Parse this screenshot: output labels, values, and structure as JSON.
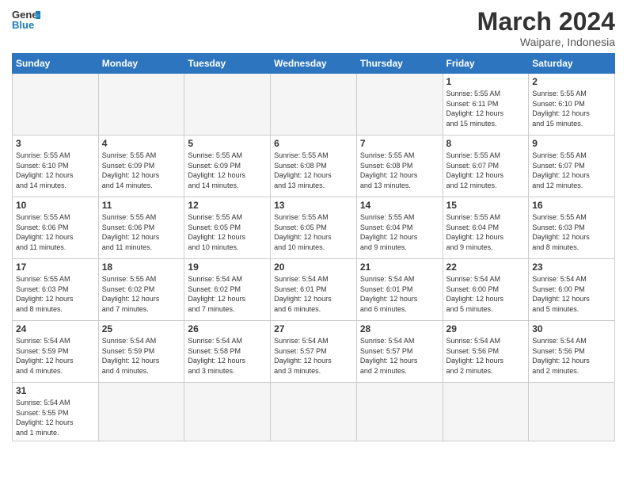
{
  "logo": {
    "line1": "General",
    "line2": "Blue"
  },
  "title": "March 2024",
  "subtitle": "Waipare, Indonesia",
  "days_of_week": [
    "Sunday",
    "Monday",
    "Tuesday",
    "Wednesday",
    "Thursday",
    "Friday",
    "Saturday"
  ],
  "weeks": [
    [
      {
        "day": "",
        "info": "",
        "empty": true
      },
      {
        "day": "",
        "info": "",
        "empty": true
      },
      {
        "day": "",
        "info": "",
        "empty": true
      },
      {
        "day": "",
        "info": "",
        "empty": true
      },
      {
        "day": "",
        "info": "",
        "empty": true
      },
      {
        "day": "1",
        "info": "Sunrise: 5:55 AM\nSunset: 6:11 PM\nDaylight: 12 hours\nand 15 minutes."
      },
      {
        "day": "2",
        "info": "Sunrise: 5:55 AM\nSunset: 6:10 PM\nDaylight: 12 hours\nand 15 minutes."
      }
    ],
    [
      {
        "day": "3",
        "info": "Sunrise: 5:55 AM\nSunset: 6:10 PM\nDaylight: 12 hours\nand 14 minutes."
      },
      {
        "day": "4",
        "info": "Sunrise: 5:55 AM\nSunset: 6:09 PM\nDaylight: 12 hours\nand 14 minutes."
      },
      {
        "day": "5",
        "info": "Sunrise: 5:55 AM\nSunset: 6:09 PM\nDaylight: 12 hours\nand 14 minutes."
      },
      {
        "day": "6",
        "info": "Sunrise: 5:55 AM\nSunset: 6:08 PM\nDaylight: 12 hours\nand 13 minutes."
      },
      {
        "day": "7",
        "info": "Sunrise: 5:55 AM\nSunset: 6:08 PM\nDaylight: 12 hours\nand 13 minutes."
      },
      {
        "day": "8",
        "info": "Sunrise: 5:55 AM\nSunset: 6:07 PM\nDaylight: 12 hours\nand 12 minutes."
      },
      {
        "day": "9",
        "info": "Sunrise: 5:55 AM\nSunset: 6:07 PM\nDaylight: 12 hours\nand 12 minutes."
      }
    ],
    [
      {
        "day": "10",
        "info": "Sunrise: 5:55 AM\nSunset: 6:06 PM\nDaylight: 12 hours\nand 11 minutes."
      },
      {
        "day": "11",
        "info": "Sunrise: 5:55 AM\nSunset: 6:06 PM\nDaylight: 12 hours\nand 11 minutes."
      },
      {
        "day": "12",
        "info": "Sunrise: 5:55 AM\nSunset: 6:05 PM\nDaylight: 12 hours\nand 10 minutes."
      },
      {
        "day": "13",
        "info": "Sunrise: 5:55 AM\nSunset: 6:05 PM\nDaylight: 12 hours\nand 10 minutes."
      },
      {
        "day": "14",
        "info": "Sunrise: 5:55 AM\nSunset: 6:04 PM\nDaylight: 12 hours\nand 9 minutes."
      },
      {
        "day": "15",
        "info": "Sunrise: 5:55 AM\nSunset: 6:04 PM\nDaylight: 12 hours\nand 9 minutes."
      },
      {
        "day": "16",
        "info": "Sunrise: 5:55 AM\nSunset: 6:03 PM\nDaylight: 12 hours\nand 8 minutes."
      }
    ],
    [
      {
        "day": "17",
        "info": "Sunrise: 5:55 AM\nSunset: 6:03 PM\nDaylight: 12 hours\nand 8 minutes."
      },
      {
        "day": "18",
        "info": "Sunrise: 5:55 AM\nSunset: 6:02 PM\nDaylight: 12 hours\nand 7 minutes."
      },
      {
        "day": "19",
        "info": "Sunrise: 5:54 AM\nSunset: 6:02 PM\nDaylight: 12 hours\nand 7 minutes."
      },
      {
        "day": "20",
        "info": "Sunrise: 5:54 AM\nSunset: 6:01 PM\nDaylight: 12 hours\nand 6 minutes."
      },
      {
        "day": "21",
        "info": "Sunrise: 5:54 AM\nSunset: 6:01 PM\nDaylight: 12 hours\nand 6 minutes."
      },
      {
        "day": "22",
        "info": "Sunrise: 5:54 AM\nSunset: 6:00 PM\nDaylight: 12 hours\nand 5 minutes."
      },
      {
        "day": "23",
        "info": "Sunrise: 5:54 AM\nSunset: 6:00 PM\nDaylight: 12 hours\nand 5 minutes."
      }
    ],
    [
      {
        "day": "24",
        "info": "Sunrise: 5:54 AM\nSunset: 5:59 PM\nDaylight: 12 hours\nand 4 minutes."
      },
      {
        "day": "25",
        "info": "Sunrise: 5:54 AM\nSunset: 5:59 PM\nDaylight: 12 hours\nand 4 minutes."
      },
      {
        "day": "26",
        "info": "Sunrise: 5:54 AM\nSunset: 5:58 PM\nDaylight: 12 hours\nand 3 minutes."
      },
      {
        "day": "27",
        "info": "Sunrise: 5:54 AM\nSunset: 5:57 PM\nDaylight: 12 hours\nand 3 minutes."
      },
      {
        "day": "28",
        "info": "Sunrise: 5:54 AM\nSunset: 5:57 PM\nDaylight: 12 hours\nand 2 minutes."
      },
      {
        "day": "29",
        "info": "Sunrise: 5:54 AM\nSunset: 5:56 PM\nDaylight: 12 hours\nand 2 minutes."
      },
      {
        "day": "30",
        "info": "Sunrise: 5:54 AM\nSunset: 5:56 PM\nDaylight: 12 hours\nand 2 minutes."
      }
    ],
    [
      {
        "day": "31",
        "info": "Sunrise: 5:54 AM\nSunset: 5:55 PM\nDaylight: 12 hours\nand 1 minute.",
        "last": true
      },
      {
        "day": "",
        "info": "",
        "empty": true,
        "last": true
      },
      {
        "day": "",
        "info": "",
        "empty": true,
        "last": true
      },
      {
        "day": "",
        "info": "",
        "empty": true,
        "last": true
      },
      {
        "day": "",
        "info": "",
        "empty": true,
        "last": true
      },
      {
        "day": "",
        "info": "",
        "empty": true,
        "last": true
      },
      {
        "day": "",
        "info": "",
        "empty": true,
        "last": true
      }
    ]
  ]
}
